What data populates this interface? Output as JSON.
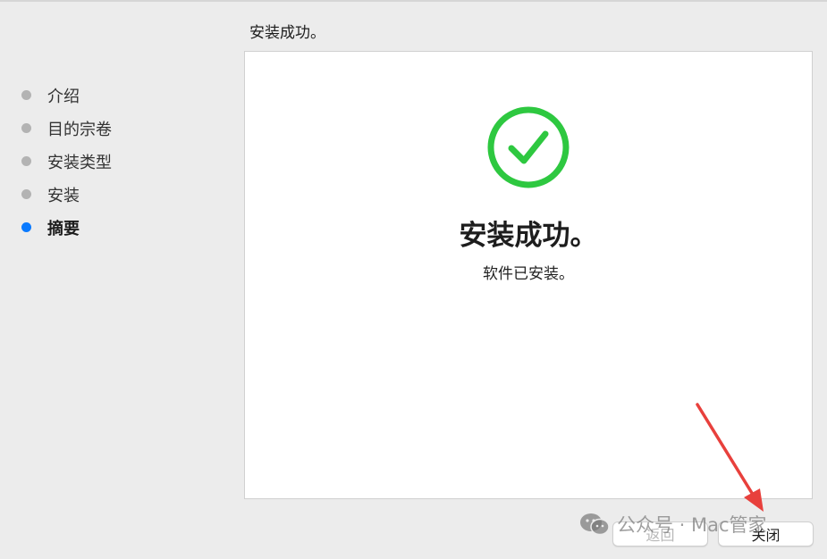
{
  "header": {
    "title": "安装成功。"
  },
  "sidebar": {
    "items": [
      {
        "label": "介绍",
        "active": false
      },
      {
        "label": "目的宗卷",
        "active": false
      },
      {
        "label": "安装类型",
        "active": false
      },
      {
        "label": "安装",
        "active": false
      },
      {
        "label": "摘要",
        "active": true
      }
    ]
  },
  "content": {
    "icon": "checkmark-circle-icon",
    "heading": "安装成功。",
    "subtext": "软件已安装。"
  },
  "buttons": {
    "back_label": "返回",
    "close_label": "关闭"
  },
  "watermark": {
    "text": "公众号 · Mac管家",
    "icon": "wechat-icon"
  },
  "annotation": {
    "icon": "red-arrow-icon"
  },
  "colors": {
    "accent": "#0a7aff",
    "success_green": "#2ec840",
    "arrow_red": "#e8403c",
    "inactive_dot": "#b3b3b3"
  }
}
